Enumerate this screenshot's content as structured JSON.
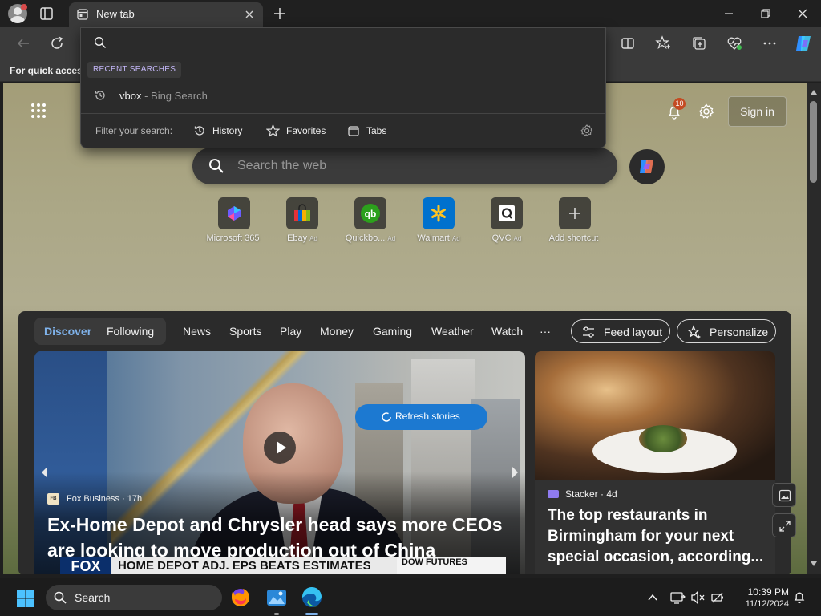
{
  "browser": {
    "tab_title": "New tab",
    "favorites_bar_text": "For quick access"
  },
  "omnibox": {
    "input_value": "",
    "recent_label": "RECENT SEARCHES",
    "recent_query": "vbox",
    "recent_source": " - Bing Search",
    "filter_label": "Filter your search:",
    "filters": [
      "History",
      "Favorites",
      "Tabs"
    ]
  },
  "newtab": {
    "notification_count": "10",
    "signin_label": "Sign in",
    "search_placeholder": "Search the web",
    "quick_links": [
      {
        "label": "Microsoft 365",
        "ad": ""
      },
      {
        "label": "Ebay",
        "ad": "Ad"
      },
      {
        "label": "Quickbo...",
        "ad": "Ad"
      },
      {
        "label": "Walmart",
        "ad": "Ad"
      },
      {
        "label": "QVC",
        "ad": "Ad"
      },
      {
        "label": "Add shortcut",
        "ad": ""
      }
    ]
  },
  "feed": {
    "toggle": {
      "discover": "Discover",
      "following": "Following"
    },
    "categories": [
      "News",
      "Sports",
      "Play",
      "Money",
      "Gaming",
      "Weather",
      "Watch",
      "···"
    ],
    "feed_layout_label": "Feed layout",
    "personalize_label": "Personalize",
    "refresh_label": "Refresh stories",
    "hero": {
      "source": "Fox Business · 17h",
      "headline": "Ex-Home Depot and Chrysler head says more CEOs are looking to move production out of China",
      "ticker_logo": "FOX",
      "ticker_text": "HOME DEPOT ADJ. EPS BEATS ESTIMATES",
      "ticker_dow": "DOW FUTURES"
    },
    "side": {
      "source": "Stacker · 4d",
      "headline": "The top restaurants in Birmingham for your next special occasion, according..."
    }
  },
  "taskbar": {
    "search_label": "Search",
    "time": "10:39 PM",
    "date": "11/12/2024"
  },
  "colors": {
    "accent": "#1c79d1",
    "discover_text": "#7fb2ea",
    "recent_label_text": "#c3b6f7",
    "notification_badge": "#c44a22"
  }
}
